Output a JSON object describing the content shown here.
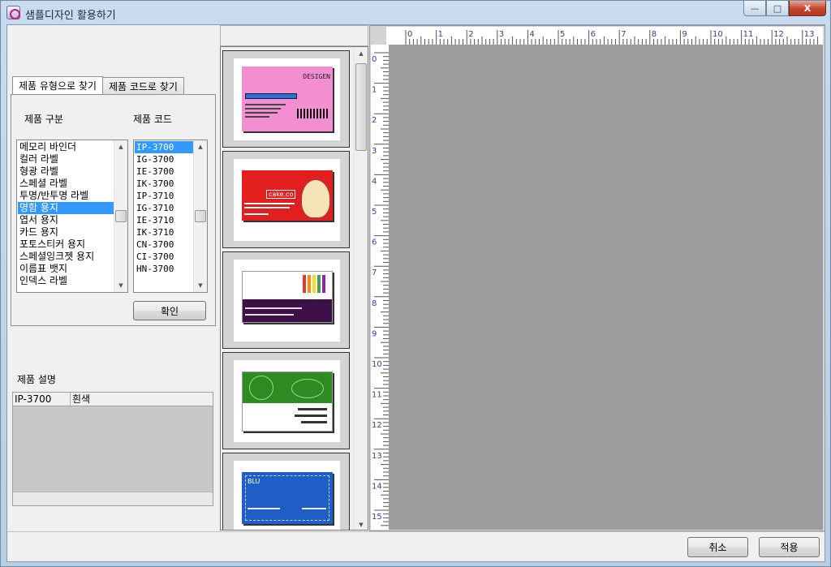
{
  "window": {
    "title": "샘플디자인 활용하기",
    "controls": {
      "minimize": "—",
      "maximize": "□",
      "close": "X"
    }
  },
  "tabs": [
    {
      "label": "제품 유형으로 찾기",
      "active": true
    },
    {
      "label": "제품 코드로 찾기",
      "active": false
    }
  ],
  "category": {
    "label": "제품 구분",
    "items": [
      "메모리 바인더",
      "컬러 라벨",
      "형광 라벨",
      "스페셜 라벨",
      "투명/반투명 라벨",
      "명함 용지",
      "엽서 용지",
      "카드 용지",
      "포토스티커 용지",
      "스페셜잉크젯 용지",
      "이름표 뱃지",
      "인덱스 라벨"
    ],
    "selected_index": 5
  },
  "code": {
    "label": "제품 코드",
    "items": [
      "IP-3700",
      "IG-3700",
      "IE-3700",
      "IK-3700",
      "IP-3710",
      "IG-3710",
      "IE-3710",
      "IK-3710",
      "CN-3700",
      "CI-3700",
      "HN-3700"
    ],
    "selected_index": 0
  },
  "confirm_button": "확인",
  "description": {
    "label": "제품 설명",
    "code": "IP-3700",
    "value": "흰색"
  },
  "thumbnails": [
    {
      "name": "design-thumbnail-1",
      "bg": "#f38fd0",
      "text": "DESIGEN"
    },
    {
      "name": "design-thumbnail-2",
      "bg": "#e31e1e",
      "text": "cake.co"
    },
    {
      "name": "design-thumbnail-3",
      "bg": "#ffffff",
      "text": ""
    },
    {
      "name": "design-thumbnail-4",
      "bg": "#2e8b22",
      "text": ""
    },
    {
      "name": "design-thumbnail-5",
      "bg": "#1f5ec6",
      "text": "BLU"
    }
  ],
  "ruler": {
    "h_labels": [
      "0",
      "1",
      "2",
      "3",
      "4",
      "5",
      "6",
      "7",
      "8",
      "9",
      "10",
      "11",
      "12",
      "13"
    ],
    "v_labels": [
      "0",
      "1",
      "2",
      "3",
      "4",
      "5",
      "6",
      "7",
      "8",
      "9",
      "10",
      "11",
      "12",
      "13",
      "14",
      "15"
    ]
  },
  "footer": {
    "cancel": "취소",
    "apply": "적용"
  },
  "colors": {
    "selection": "#3399ff",
    "canvas": "#9a9c9e",
    "ruler_text": "#3a3a9a"
  }
}
